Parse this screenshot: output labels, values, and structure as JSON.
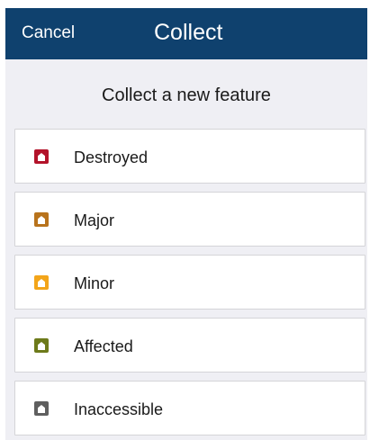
{
  "navbar": {
    "cancel_label": "Cancel",
    "title": "Collect"
  },
  "heading": "Collect a new feature",
  "features": [
    {
      "label": "Destroyed",
      "icon": "damage-destroyed-icon",
      "color": "#b3132a"
    },
    {
      "label": "Major",
      "icon": "damage-major-icon",
      "color": "#b8731c"
    },
    {
      "label": "Minor",
      "icon": "damage-minor-icon",
      "color": "#f3a51a"
    },
    {
      "label": "Affected",
      "icon": "damage-affected-icon",
      "color": "#6d7a1a"
    },
    {
      "label": "Inaccessible",
      "icon": "inaccessible-icon",
      "color": "#5f5f5f"
    }
  ]
}
